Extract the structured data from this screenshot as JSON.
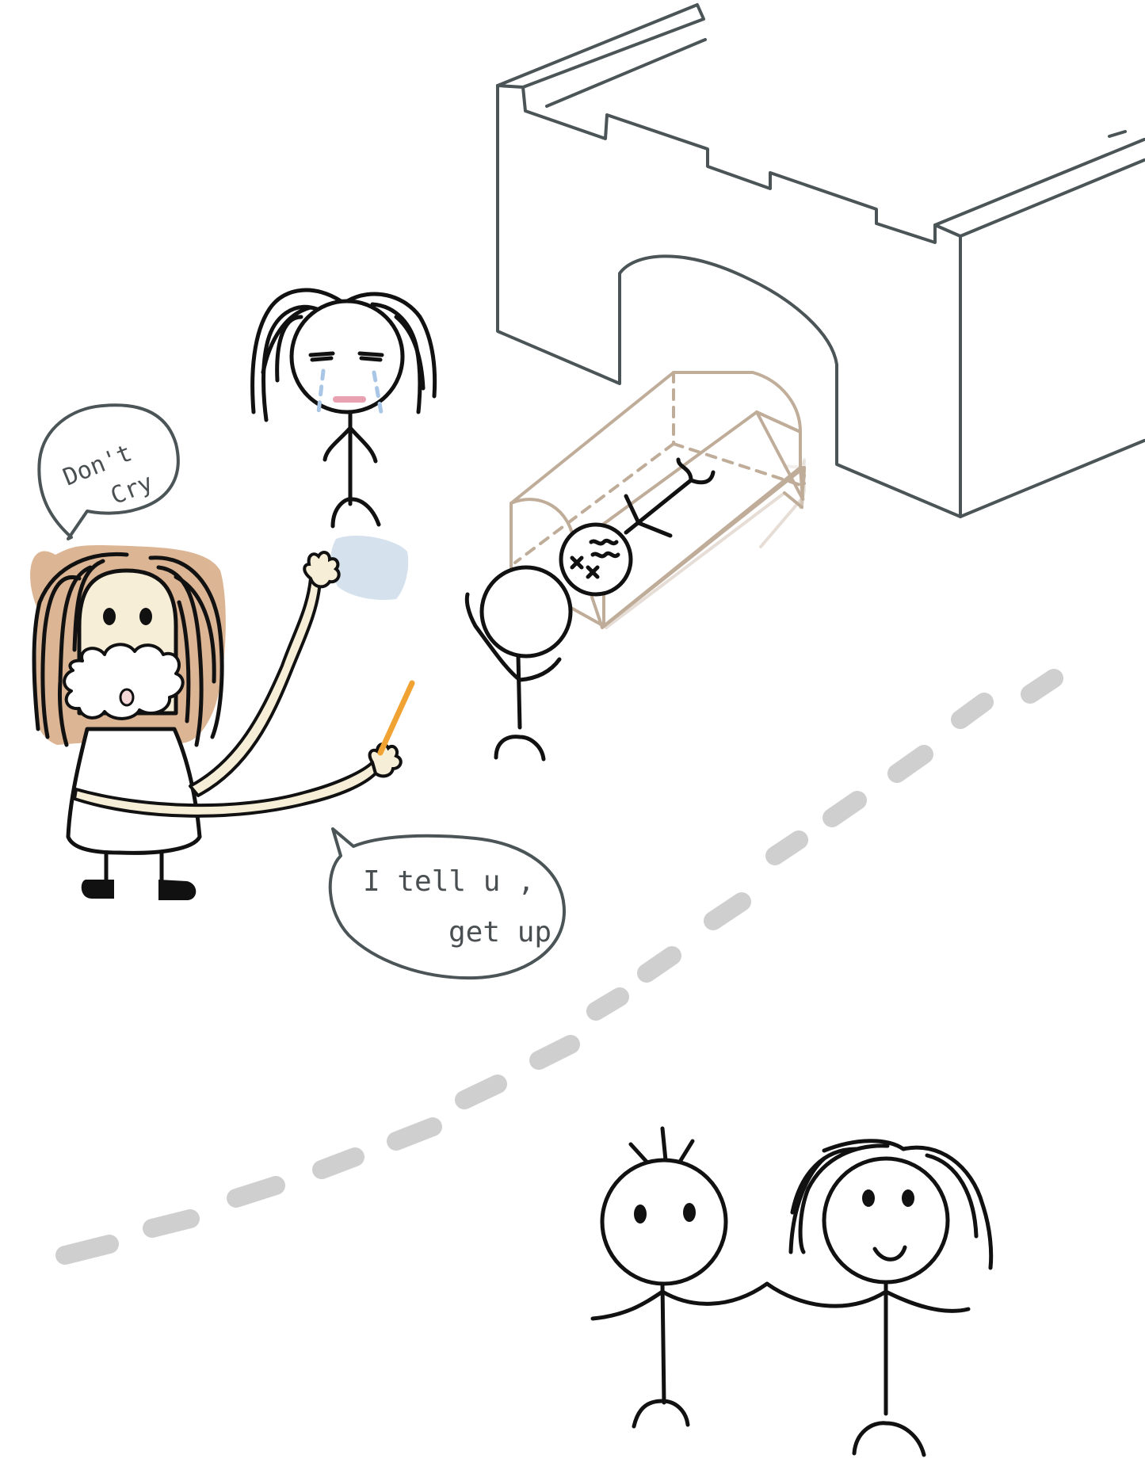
{
  "bubbles": {
    "dont_cry": {
      "line1": "Don't",
      "line2": "Cry"
    },
    "get_up": {
      "line1": "I tell u ,",
      "line2": "get up"
    }
  },
  "colors": {
    "ink": "#111111",
    "castle_outline": "#4b5457",
    "bubble_outline": "#4b5457",
    "hair_fill": "#dcb594",
    "face_fill": "#f6eed7",
    "coffin_outline": "#b9a48f",
    "dashed_path": "#cfcfcf",
    "tears": "#a9c6e6",
    "wand": "#f0a332",
    "cloth": "#d6e1ee"
  },
  "icons": {
    "castle": "castle-icon",
    "coffin": "coffin-icon",
    "wand": "wand-icon"
  }
}
